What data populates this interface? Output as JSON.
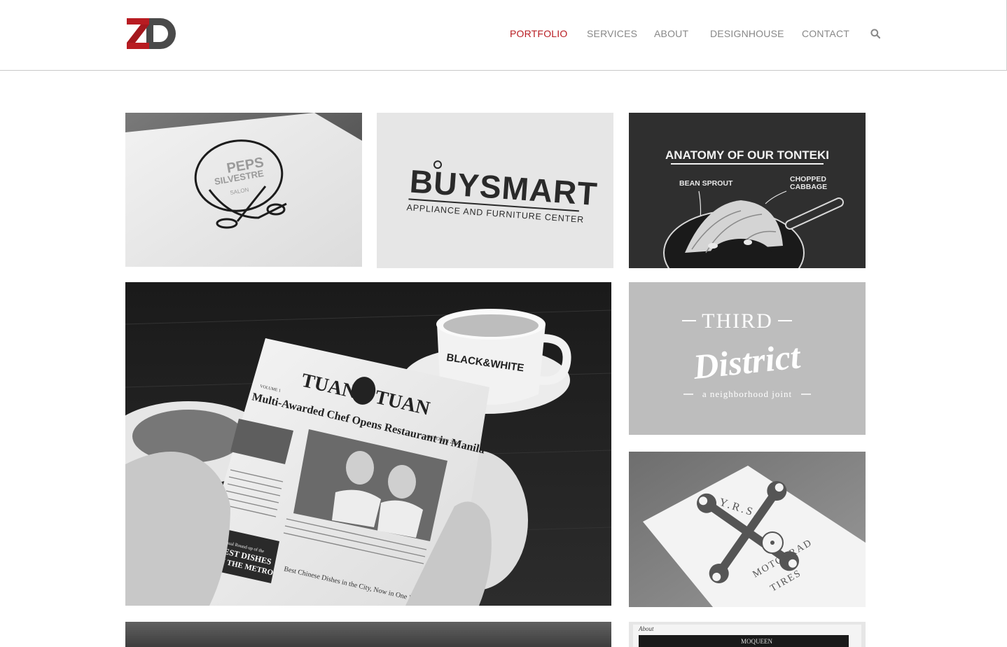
{
  "brand": {
    "logo_letters": "ZD",
    "accent": "#b81c22",
    "dark": "#4a4a4a"
  },
  "nav": {
    "items": [
      {
        "label": "PORTFOLIO",
        "active": true
      },
      {
        "label": "SERVICES",
        "active": false
      },
      {
        "label": "ABOUT",
        "active": false
      },
      {
        "label": "DESIGNHOUSE",
        "active": false
      },
      {
        "label": "CONTACT",
        "active": false
      }
    ],
    "search_icon": "search-icon"
  },
  "portfolio": {
    "peps": {
      "line1": "PEPS",
      "line2": "SILVESTRE",
      "line3": "SALON"
    },
    "buysmart": {
      "name": "BUYSMART",
      "tagline": "APPLIANCE AND FURNITURE CENTER"
    },
    "tonteki": {
      "title": "ANATOMY OF OUR TONTEKI",
      "label_left": "BEAN SPROUT",
      "label_right_1": "CHOPPED",
      "label_right_2": "CABBAGE"
    },
    "tuantuan": {
      "masthead_left": "TUAN",
      "masthead_right": "TUAN",
      "volume": "VOLUME 1",
      "date": "OCTOBER 2014",
      "headline": "Multi-Awarded Chef Opens Restaurant in Manila",
      "sidebar_1": "Annual Round-up of the",
      "sidebar_2": "BEST DISHES",
      "sidebar_3": "IN THE METRO",
      "subhead": "Best Chinese Dishes in the City, Now in One Place",
      "cup_text": "BLACK&WHITE"
    },
    "third_district": {
      "line1": "THIRD",
      "line2": "District",
      "line3": "a neighborhood joint"
    },
    "yrs": {
      "top": "Y.R.S.",
      "bottom_1": "MOTORRAD",
      "bottom_2": "TIRES"
    },
    "about": {
      "tag": "About",
      "banner": "MOQUEEN"
    }
  }
}
